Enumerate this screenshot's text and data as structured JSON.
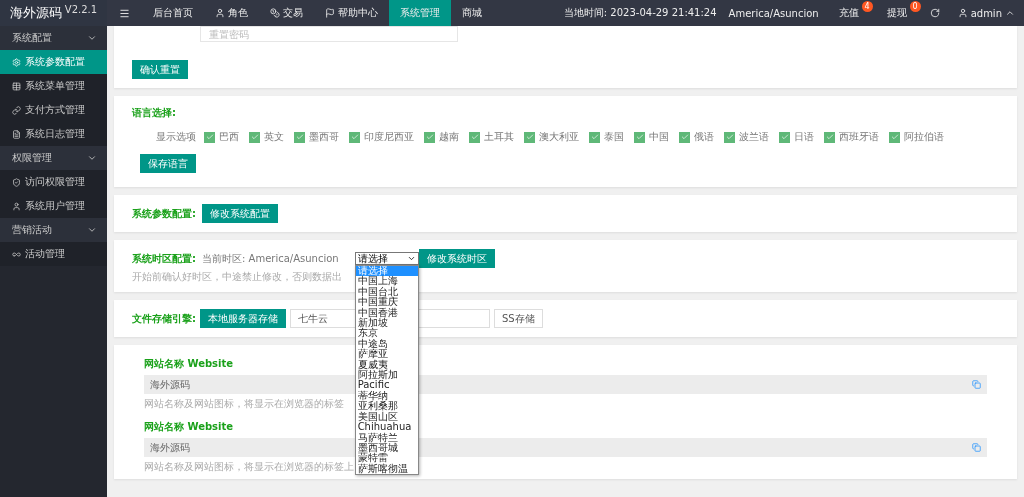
{
  "brand": {
    "name": "海外源码",
    "version": "V2.2.1"
  },
  "top_nav": [
    {
      "label": "后台首页",
      "selected": false
    },
    {
      "label": "角色",
      "selected": false
    },
    {
      "label": "交易",
      "selected": false
    },
    {
      "label": "帮助中心",
      "selected": false
    },
    {
      "label": "系统管理",
      "selected": true
    },
    {
      "label": "商城",
      "selected": false
    }
  ],
  "header_right": {
    "time_label": "当地时间: 2023-04-29 21:41:24",
    "timezone": "America/Asuncion",
    "links": [
      {
        "label": "充值",
        "badge": "4"
      },
      {
        "label": "提现",
        "badge": "0"
      }
    ],
    "user": "admin"
  },
  "sidebar": [
    {
      "label": "系统配置",
      "expanded": true,
      "children": [
        {
          "label": "系统参数配置",
          "selected": true
        },
        {
          "label": "系统菜单管理",
          "selected": false
        },
        {
          "label": "支付方式管理",
          "selected": false
        },
        {
          "label": "系统日志管理",
          "selected": false
        }
      ]
    },
    {
      "label": "权限管理",
      "expanded": true,
      "children": [
        {
          "label": "访问权限管理",
          "selected": false
        },
        {
          "label": "系统用户管理",
          "selected": false
        }
      ]
    },
    {
      "label": "营销活动",
      "expanded": true,
      "children": [
        {
          "label": "活动管理",
          "selected": false
        }
      ]
    }
  ],
  "password_card": {
    "placeholder": "重置密码",
    "button": "确认重置"
  },
  "language_card": {
    "title": "语言选择:",
    "option_label": "显示选项",
    "languages": [
      {
        "label": "巴西",
        "checked": true
      },
      {
        "label": "英文",
        "checked": true
      },
      {
        "label": "墨西哥",
        "checked": true
      },
      {
        "label": "印度尼西亚",
        "checked": true
      },
      {
        "label": "越南",
        "checked": true
      },
      {
        "label": "土耳其",
        "checked": true
      },
      {
        "label": "澳大利亚",
        "checked": true
      },
      {
        "label": "泰国",
        "checked": true
      },
      {
        "label": "中国",
        "checked": true
      },
      {
        "label": "俄语",
        "checked": true
      },
      {
        "label": "波兰语",
        "checked": true
      },
      {
        "label": "日语",
        "checked": true
      },
      {
        "label": "西班牙语",
        "checked": true
      },
      {
        "label": "阿拉伯语",
        "checked": true
      }
    ],
    "button": "保存语言"
  },
  "params_card": {
    "title": "系统参数配置:",
    "button": "修改系统配置"
  },
  "timezone_card": {
    "title": "系统时区配置:",
    "current": "当前时区: America/Asuncion",
    "select_value": "请选择",
    "button": "修改系统时区",
    "hint": "开始前确认好时区，中途禁止修改，否则数据出",
    "options": [
      {
        "label": "请选择",
        "selected": true
      },
      {
        "label": "中国上海",
        "selected": false
      },
      {
        "label": "中国台北",
        "selected": false
      },
      {
        "label": "中国重庆",
        "selected": false
      },
      {
        "label": "中国香港",
        "selected": false
      },
      {
        "label": "新加坡",
        "selected": false
      },
      {
        "label": "东京",
        "selected": false
      },
      {
        "label": "中途岛",
        "selected": false
      },
      {
        "label": "萨摩亚",
        "selected": false
      },
      {
        "label": "夏威夷",
        "selected": false
      },
      {
        "label": "阿拉斯加",
        "selected": false
      },
      {
        "label": "Pacific",
        "selected": false
      },
      {
        "label": "蒂华纳",
        "selected": false
      },
      {
        "label": "亚利桑那",
        "selected": false
      },
      {
        "label": "美国山区",
        "selected": false
      },
      {
        "label": "Chihuahua",
        "selected": false
      },
      {
        "label": "马萨特兰",
        "selected": false
      },
      {
        "label": "墨西哥城",
        "selected": false
      },
      {
        "label": "蒙特雷",
        "selected": false
      },
      {
        "label": "萨斯喀彻温",
        "selected": false
      }
    ]
  },
  "storage_card": {
    "title": "文件存储引擎:",
    "options": [
      {
        "label": "本地服务器存储",
        "selected": true
      },
      {
        "label": "七牛云",
        "selected": false
      },
      {
        "label": "SS存储",
        "selected": false
      }
    ]
  },
  "site_card": {
    "fields": [
      {
        "label": "网站名称 Website",
        "value": "海外源码",
        "hint": "网站名称及网站图标，将显示在浏览器的标签"
      },
      {
        "label": "网站名称 Website",
        "value": "海外源码",
        "hint": "网站名称及网站图标，将显示在浏览器的标签上"
      }
    ]
  }
}
